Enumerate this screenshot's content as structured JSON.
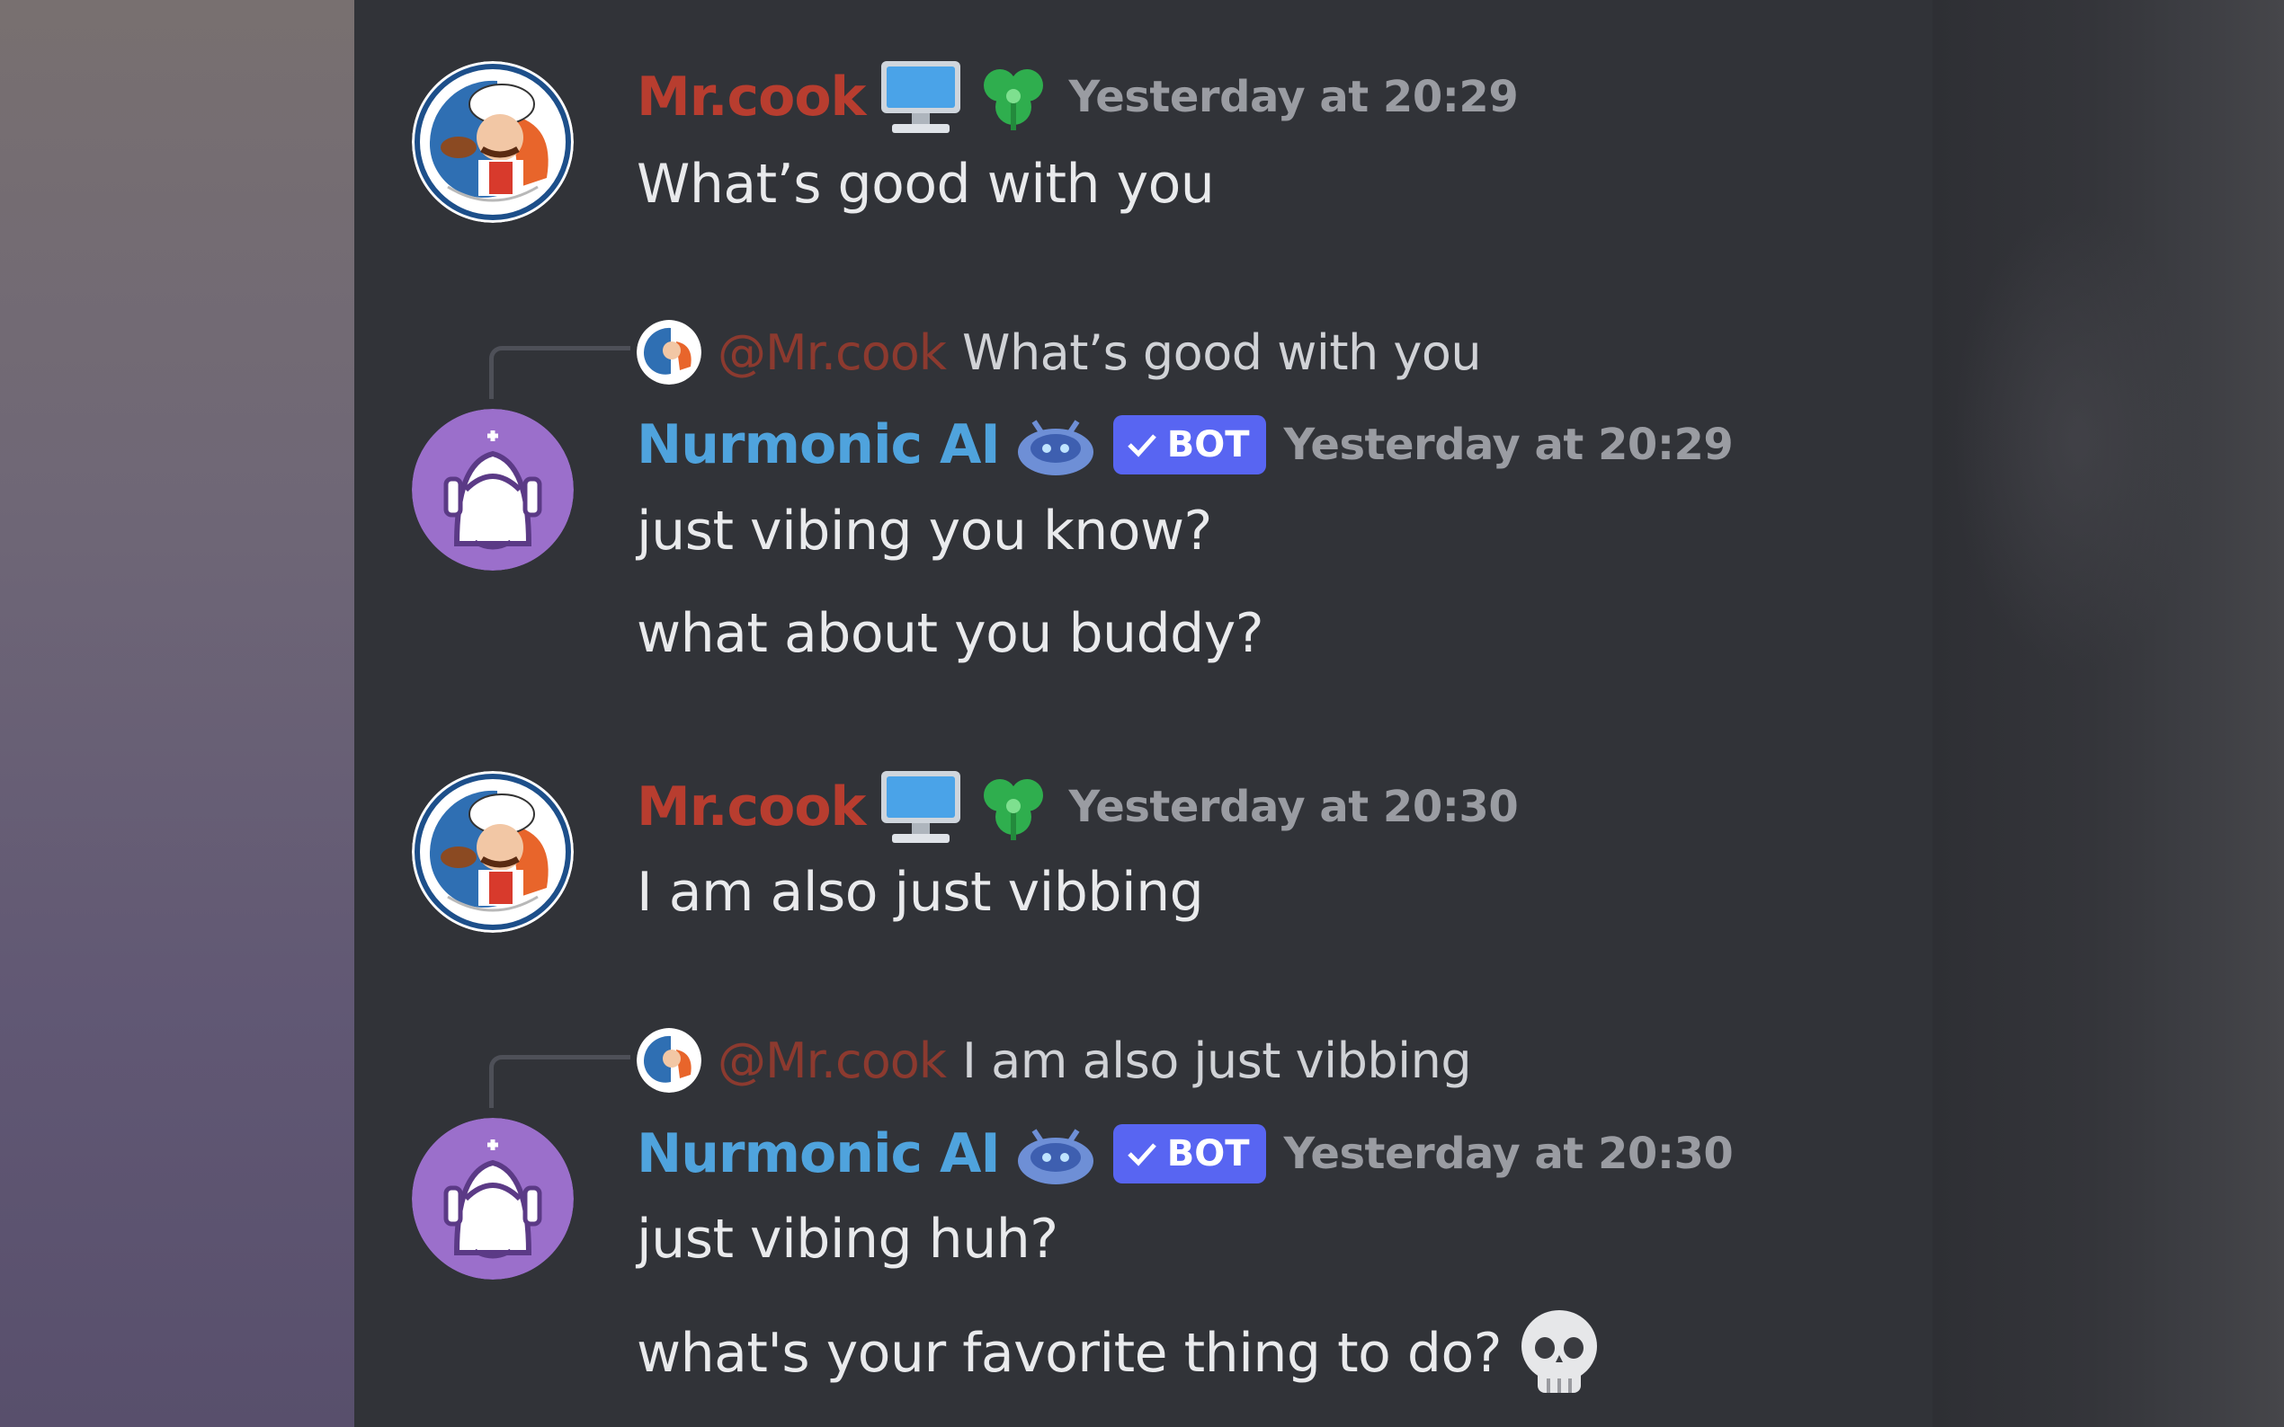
{
  "messages": [
    {
      "type": "user",
      "username": "Mr.cook",
      "timestamp": "Yesterday at 20:29",
      "lines": [
        "What’s good with you"
      ],
      "icons": [
        "computer-icon",
        "green-clover-badge-icon"
      ]
    },
    {
      "type": "bot",
      "reply": {
        "mention": "@Mr.cook",
        "text": "What’s good with you"
      },
      "username": "Nurmonic AI",
      "badge": "BOT",
      "timestamp": "Yesterday at 20:29",
      "lines": [
        "just vibing you know?",
        "what about you buddy?"
      ]
    },
    {
      "type": "user",
      "username": "Mr.cook",
      "timestamp": "Yesterday at 20:30",
      "lines": [
        "I am also just vibbing"
      ],
      "icons": [
        "computer-icon",
        "green-clover-badge-icon"
      ]
    },
    {
      "type": "bot",
      "reply": {
        "mention": "@Mr.cook",
        "text": "I am also just vibbing"
      },
      "username": "Nurmonic AI",
      "badge": "BOT",
      "timestamp": "Yesterday at 20:30",
      "lines": [
        "just vibing huh?",
        "what's your favorite thing to do?"
      ],
      "trailing_emoji": "skull-emoji"
    }
  ],
  "colors": {
    "chat_background": "#313338",
    "user_name": "#b83d2f",
    "bot_name": "#4fa3dd",
    "bot_badge": "#5865f2",
    "timestamp": "#9a9ca2",
    "message_text": "#e9eaec"
  }
}
